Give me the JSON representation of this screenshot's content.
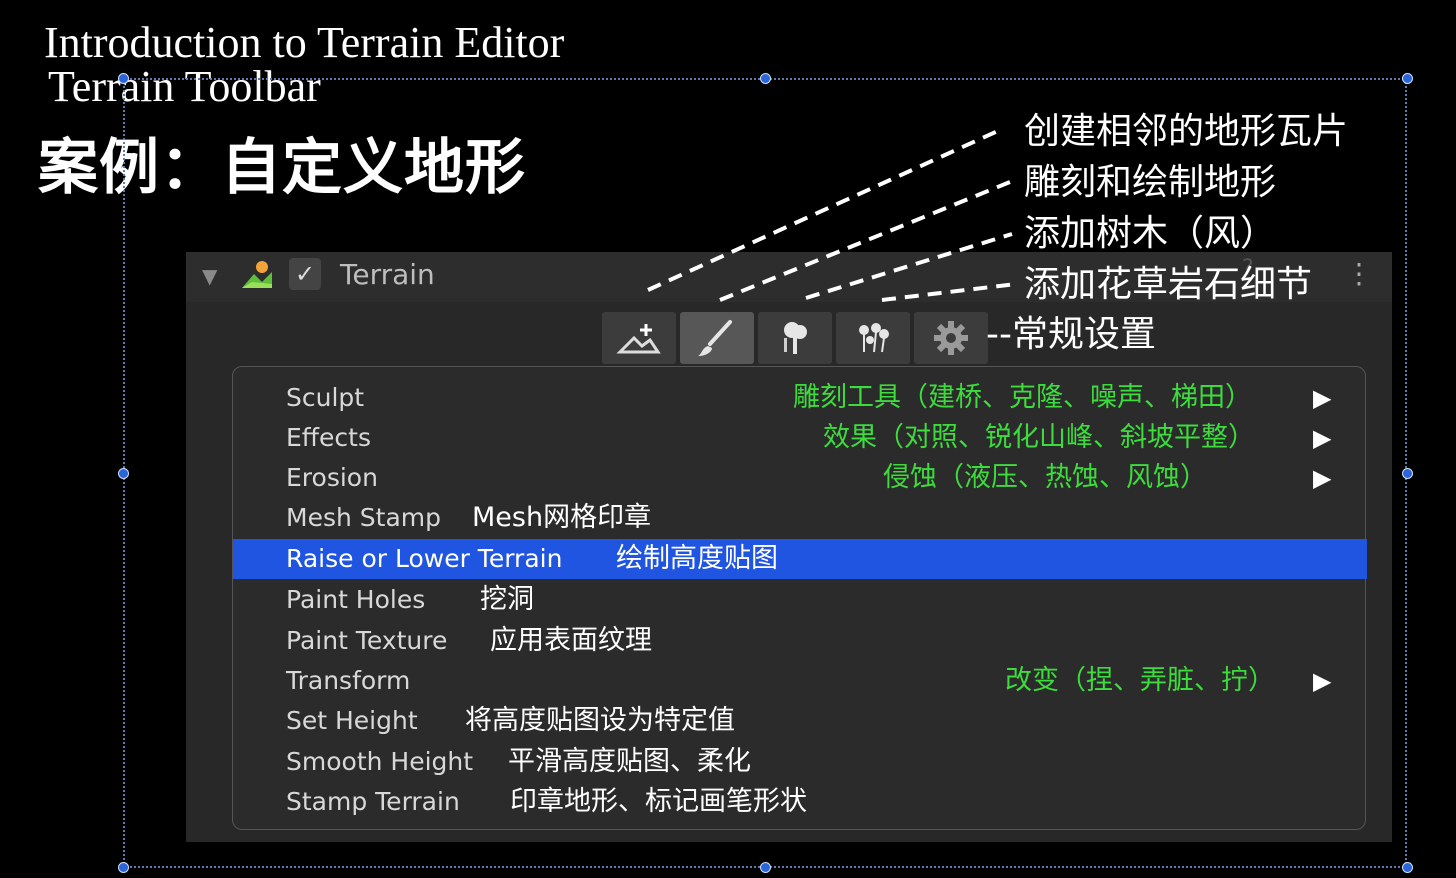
{
  "slide": {
    "title_line1": "Introduction to Terrain Editor",
    "title_line2": "Terrain Toolbar",
    "heading": "案例：自定义地形"
  },
  "panel": {
    "component_name": "Terrain",
    "enabled_mark": "✓",
    "fold_glyph": "▼",
    "kebab_glyph": "⋮",
    "help_glyph": "?"
  },
  "toolbar": {
    "tools": [
      {
        "icon": "create-neighbor-terrain-icon"
      },
      {
        "icon": "paint-brush-icon",
        "active": true
      },
      {
        "icon": "tree-icon"
      },
      {
        "icon": "flower-details-icon"
      },
      {
        "icon": "gear-icon"
      }
    ]
  },
  "callouts": [
    "创建相邻的地形瓦片",
    "雕刻和绘制地形",
    "添加树木（风）",
    "添加花草岩石细节",
    "--常规设置"
  ],
  "menu": {
    "submenu_glyph": "▶",
    "items": [
      {
        "label": "Sculpt",
        "note": "雕刻工具（建桥、克隆、噪声、梯田）",
        "submenu": true
      },
      {
        "label": "Effects",
        "note": "效果（对照、锐化山峰、斜坡平整）",
        "submenu": true
      },
      {
        "label": "Erosion",
        "note": "侵蚀（液压、热蚀、风蚀）",
        "submenu": true
      },
      {
        "label": "Mesh Stamp",
        "note": "Mesh网格印章"
      },
      {
        "label": "Raise or Lower Terrain",
        "note": "绘制高度贴图",
        "selected": true
      },
      {
        "label": "Paint Holes",
        "note": "挖洞"
      },
      {
        "label": "Paint Texture",
        "note": "应用表面纹理"
      },
      {
        "label": "Transform",
        "note": "改变（捏、弄脏、拧）",
        "submenu": true
      },
      {
        "label": "Set Height",
        "note": "将高度贴图设为特定值"
      },
      {
        "label": "Smooth Height",
        "note": "平滑高度贴图、柔化"
      },
      {
        "label": "Stamp Terrain",
        "note": "印章地形、标记画笔形状"
      }
    ]
  },
  "colors": {
    "accent_selected": "#1f55e0",
    "annotation_green": "#3ddc3d",
    "frame_handle": "#2a66d8"
  }
}
